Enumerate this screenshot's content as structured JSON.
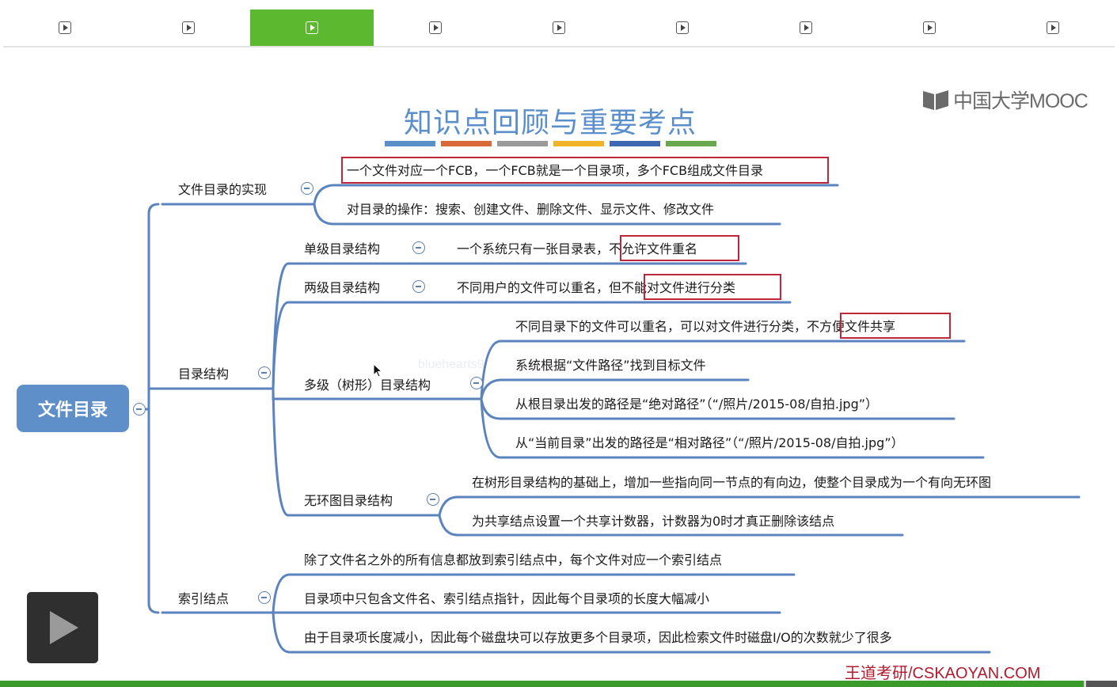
{
  "tabs": [
    {
      "index": 1,
      "active": false
    },
    {
      "index": 2,
      "active": false
    },
    {
      "index": 3,
      "active": true
    },
    {
      "index": 4,
      "active": false
    },
    {
      "index": 5,
      "active": false
    },
    {
      "index": 6,
      "active": false
    },
    {
      "index": 7,
      "active": false
    },
    {
      "index": 8,
      "active": false
    },
    {
      "index": 9,
      "active": false
    }
  ],
  "logo": {
    "text": "中国大学MOOC",
    "icon": "mooc-book-icon"
  },
  "slide": {
    "title": "知识点回顾与重要考点",
    "swatch_colors": [
      "#5b8fc9",
      "#d9693b",
      "#9a9a9a",
      "#f0b429",
      "#3d67b1",
      "#6aa84f"
    ],
    "root": "文件目录",
    "branches": {
      "impl": {
        "label": "文件目录的实现",
        "items": [
          "一个文件对应一个FCB，一个FCB就是一个目录项，多个FCB组成文件目录",
          "对目录的操作：搜索、创建文件、删除文件、显示文件、修改文件"
        ]
      },
      "structure": {
        "label": "目录结构",
        "single": {
          "label": "单级目录结构",
          "text": "一个系统只有一张目录表，",
          "highlight": "不允许文件重名"
        },
        "two": {
          "label": "两级目录结构",
          "text": "不同用户的文件可以重名，但",
          "highlight": "不能对文件进行分类"
        },
        "multi": {
          "label": "多级（树形）目录结构",
          "items": [
            {
              "text": "不同目录下的文件可以重名，可以对文件进行分类，",
              "highlight": "不方便文件共享"
            },
            {
              "text": "系统根据“文件路径”找到目标文件"
            },
            {
              "text": "从根目录出发的路径是“绝对路径”（“/照片/2015-08/自拍.jpg”）"
            },
            {
              "text": "从“当前目录”出发的路径是“相对路径”（“/照片/2015-08/自拍.jpg”）"
            }
          ]
        },
        "dag": {
          "label": "无环图目录结构",
          "items": [
            "在树形目录结构的基础上，增加一些指向同一节点的有向边，使整个目录成为一个有向无环图",
            "为共享结点设置一个共享计数器，计数器为0时才真正删除该结点"
          ]
        }
      },
      "inode": {
        "label": "索引结点",
        "items": [
          "除了文件名之外的所有信息都放到索引结点中，每个文件对应一个索引结点",
          "目录项中只包含文件名、索引结点指针，因此每个目录项的长度大幅减小",
          "由于目录项长度减小，因此每个磁盘块可以存放更多个目录项，因此检索文件时磁盘I/O的次数就少了很多"
        ]
      }
    },
    "watermark": "bluehearts9",
    "brand": "王道考研/CSKAOYAN.COM"
  },
  "player": {
    "progress": 0.97,
    "play_icon": "play-icon"
  }
}
